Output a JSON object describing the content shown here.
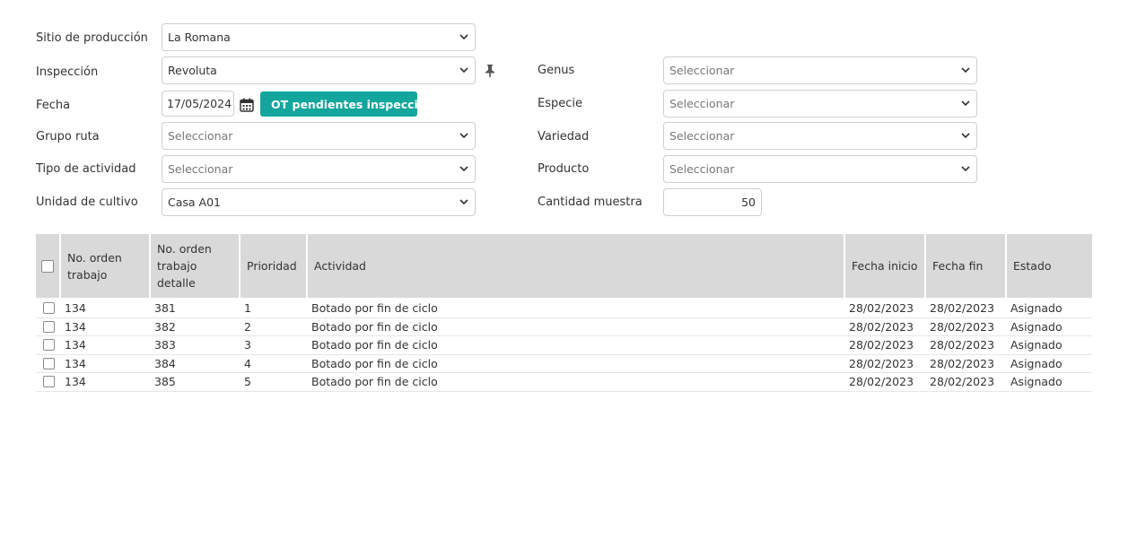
{
  "form": {
    "sitio": {
      "label": "Sitio de producción",
      "value": "La Romana"
    },
    "inspeccion": {
      "label": "Inspección",
      "value": "Revoluta"
    },
    "fecha": {
      "label": "Fecha",
      "value": "17/05/2024"
    },
    "ot_button": "OT pendientes inspección",
    "grupo_ruta": {
      "label": "Grupo ruta",
      "placeholder": "Seleccionar"
    },
    "tipo_actividad": {
      "label": "Tipo de actividad",
      "placeholder": "Seleccionar"
    },
    "unidad_cultivo": {
      "label": "Unidad de cultivo",
      "value": "Casa A01"
    },
    "genus": {
      "label": "Genus",
      "placeholder": "Seleccionar"
    },
    "especie": {
      "label": "Especie",
      "placeholder": "Seleccionar"
    },
    "variedad": {
      "label": "Variedad",
      "placeholder": "Seleccionar"
    },
    "producto": {
      "label": "Producto",
      "placeholder": "Seleccionar"
    },
    "cantidad_muestra": {
      "label": "Cantidad muestra",
      "value": "50"
    }
  },
  "table": {
    "headers": {
      "orden": "No. orden trabajo",
      "detalle": "No. orden trabajo detalle",
      "prioridad": "Prioridad",
      "actividad": "Actividad",
      "fecha_inicio": "Fecha inicio",
      "fecha_fin": "Fecha fin",
      "estado": "Estado"
    },
    "rows": [
      {
        "orden": "134",
        "detalle": "381",
        "prioridad": "1",
        "actividad": "Botado por fin de ciclo",
        "fecha_inicio": "28/02/2023",
        "fecha_fin": "28/02/2023",
        "estado": "Asignado"
      },
      {
        "orden": "134",
        "detalle": "382",
        "prioridad": "2",
        "actividad": "Botado por fin de ciclo",
        "fecha_inicio": "28/02/2023",
        "fecha_fin": "28/02/2023",
        "estado": "Asignado"
      },
      {
        "orden": "134",
        "detalle": "383",
        "prioridad": "3",
        "actividad": "Botado por fin de ciclo",
        "fecha_inicio": "28/02/2023",
        "fecha_fin": "28/02/2023",
        "estado": "Asignado"
      },
      {
        "orden": "134",
        "detalle": "384",
        "prioridad": "4",
        "actividad": "Botado por fin de ciclo",
        "fecha_inicio": "28/02/2023",
        "fecha_fin": "28/02/2023",
        "estado": "Asignado"
      },
      {
        "orden": "134",
        "detalle": "385",
        "prioridad": "5",
        "actividad": "Botado por fin de ciclo",
        "fecha_inicio": "28/02/2023",
        "fecha_fin": "28/02/2023",
        "estado": "Asignado"
      }
    ]
  },
  "colors": {
    "accent": "#12a69c",
    "header_bg": "#d9d9d9"
  }
}
